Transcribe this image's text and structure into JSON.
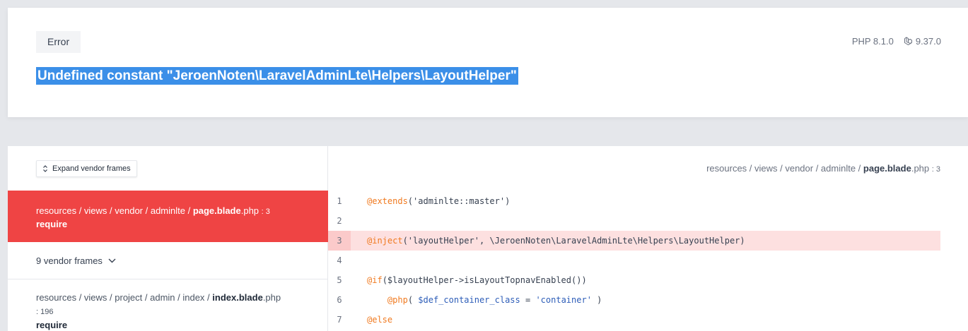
{
  "header": {
    "badge": "Error",
    "message": "Undefined constant \"JeroenNoten\\LaravelAdminLte\\Helpers\\LayoutHelper\"",
    "php_version": "PHP 8.1.0",
    "laravel_version": "9.37.0"
  },
  "frames": {
    "expand_label": "Expand vendor frames",
    "active": {
      "dir": "resources / views / vendor / adminlte / ",
      "file": "page.blade",
      "ext": ".php",
      "line": ": 3",
      "fn": "require"
    },
    "vendor_label": "9 vendor frames",
    "next": {
      "dir": "resources / views / project / admin / index / ",
      "file": "index.blade",
      "ext": ".php",
      "line": ": 196",
      "fn": "require"
    }
  },
  "code": {
    "path_dir": "resources / views / vendor / adminlte / ",
    "path_file": "page.blade",
    "path_ext": ".php",
    "path_line": ": 3",
    "lines": [
      {
        "n": "1",
        "kw": "@extends",
        "rest": "('adminlte::master')"
      },
      {
        "n": "2",
        "kw": "",
        "rest": ""
      },
      {
        "n": "3",
        "kw": "@inject",
        "rest": "('layoutHelper', \\JeroenNoten\\LaravelAdminLte\\Helpers\\LayoutHelper)"
      },
      {
        "n": "4",
        "kw": "",
        "rest": ""
      },
      {
        "n": "5",
        "kw": "@if",
        "rest": "($layoutHelper->isLayoutTopnavEnabled())"
      },
      {
        "n": "6",
        "indent": "    ",
        "kw": "@php",
        "rest": "( ",
        "var": "$def_container_class",
        "op": " = ",
        "str": "'container'",
        "tail": " )"
      },
      {
        "n": "7",
        "kw": "@else",
        "rest": ""
      }
    ]
  },
  "colors": {
    "accent_red": "#ef4444",
    "selection_blue": "#3b8fe8",
    "highlight_line": "#fde0e0",
    "keyword_orange": "#f07a20",
    "string_blue": "#2d5db8"
  }
}
